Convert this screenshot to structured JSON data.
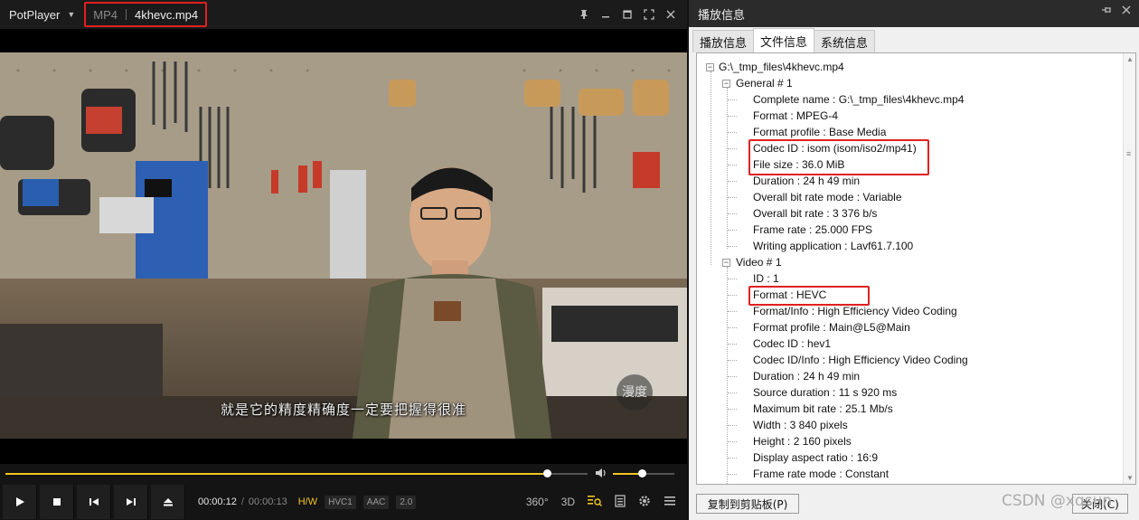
{
  "player": {
    "app_name": "PotPlayer",
    "format_label": "MP4",
    "file_name": "4khevc.mp4",
    "subtitle": "就是它的精度精确度一定要把握得很准",
    "watermark_logo_text": "漫度",
    "progress_fraction": 0.93,
    "volume_fraction": 0.47,
    "time_current": "00:00:12",
    "time_separator": "/",
    "time_total": "00:00:13",
    "hw_label": "H/W",
    "video_codec_tag": "HVC1",
    "audio_codec_tag": "AAC",
    "speed_tag": "2.0",
    "btn_360": "360°",
    "btn_3d": "3D",
    "accent_color": "#f2c420"
  },
  "info_panel": {
    "title": "播放信息",
    "tabs": [
      {
        "label": "播放信息",
        "active": false
      },
      {
        "label": "文件信息",
        "active": true
      },
      {
        "label": "系统信息",
        "active": false
      }
    ],
    "tree": {
      "root": "G:\\_tmp_files\\4khevc.mp4",
      "general_header": "General # 1",
      "general": [
        "Complete name : G:\\_tmp_files\\4khevc.mp4",
        "Format : MPEG-4",
        "Format profile : Base Media",
        "Codec ID : isom (isom/iso2/mp41)",
        "File size : 36.0 MiB",
        "Duration : 24 h 49 min",
        "Overall bit rate mode : Variable",
        "Overall bit rate : 3 376 b/s",
        "Frame rate : 25.000 FPS",
        "Writing application : Lavf61.7.100"
      ],
      "video_header": "Video # 1",
      "video": [
        "ID : 1",
        "Format : HEVC",
        "Format/Info : High Efficiency Video Coding",
        "Format profile : Main@L5@Main",
        "Codec ID : hev1",
        "Codec ID/Info : High Efficiency Video Coding",
        "Duration : 24 h 49 min",
        "Source duration : 11 s 920 ms",
        "Maximum bit rate : 25.1 Mb/s",
        "Width : 3 840 pixels",
        "Height : 2 160 pixels",
        "Display aspect ratio : 16:9",
        "Frame rate mode : Constant"
      ]
    },
    "copy_button": "复制到剪贴板(P)",
    "close_button": "关闭(C)",
    "site_watermark": "CSDN @xqsun"
  }
}
